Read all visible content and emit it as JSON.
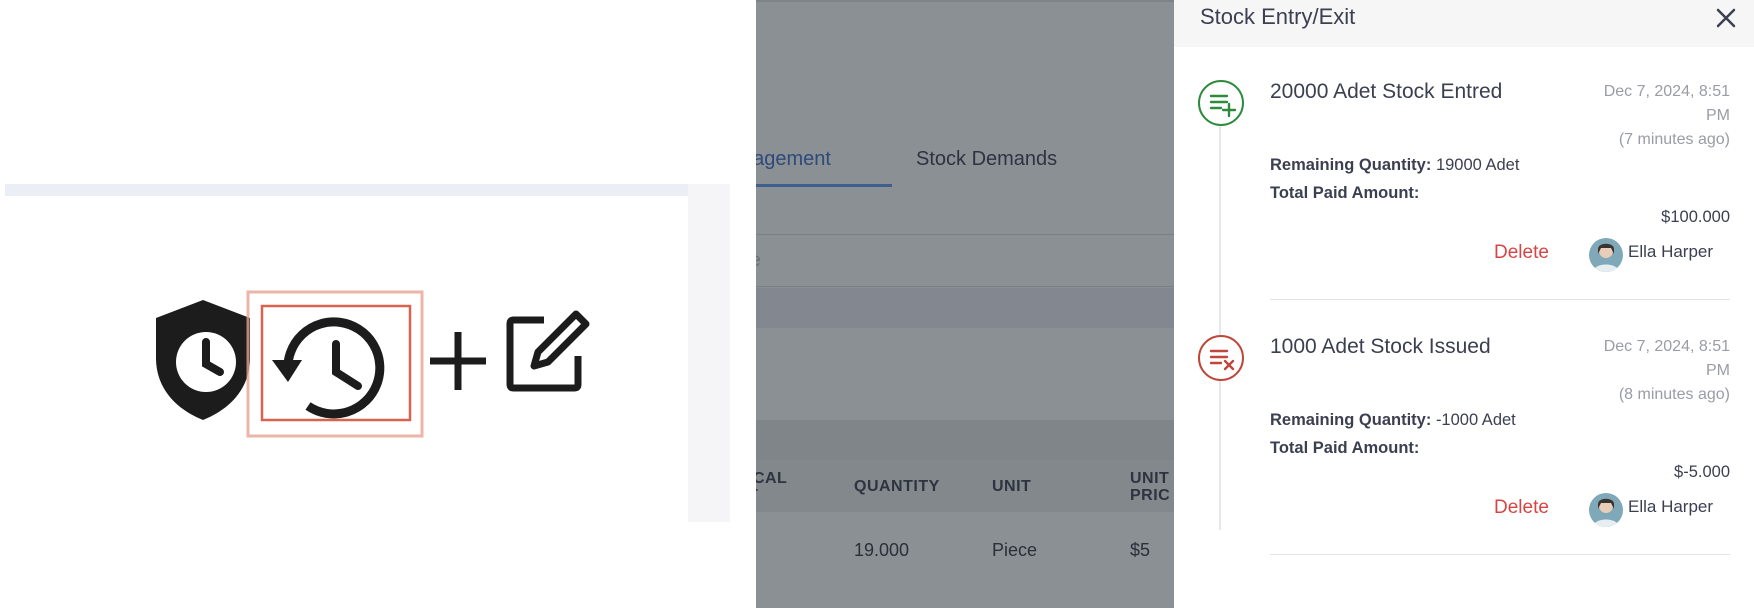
{
  "tabs": {
    "active_label": "nagement",
    "stock_demands_label": "Stock Demands"
  },
  "search": {
    "placeholder_fragment": "le"
  },
  "table": {
    "headers": [
      "ICAL\nT",
      "QUANTITY",
      "UNIT",
      "UNIT\nPRIC"
    ],
    "row": {
      "quantity": "19.000",
      "unit": "Piece",
      "price": "$5"
    }
  },
  "drawer": {
    "title": "Stock Entry/Exit",
    "entries": [
      {
        "type": "entry",
        "title": "20000 Adet Stock Entred",
        "date_line1": "Dec 7, 2024, 8:51",
        "date_line2": "PM",
        "date_ago": "(7 minutes ago)",
        "remaining_label": "Remaining Quantity:",
        "remaining_value": "19000 Adet",
        "paid_label": "Total Paid Amount:",
        "paid_value": "$100.000",
        "delete_label": "Delete",
        "user": "Ella Harper",
        "icon_color": "#2e8b3e"
      },
      {
        "type": "exit",
        "title": "1000 Adet Stock Issued",
        "date_line1": "Dec 7, 2024, 8:51",
        "date_line2": "PM",
        "date_ago": "(8 minutes ago)",
        "remaining_label": "Remaining Quantity:",
        "remaining_value": "-1000 Adet",
        "paid_label": "Total Paid Amount:",
        "paid_value": "$-5.000",
        "delete_label": "Delete",
        "user": "Ella Harper",
        "icon_color": "#c0463a"
      }
    ]
  },
  "icons": {
    "zoom": [
      "shield-clock-icon",
      "history-icon",
      "plus-icon",
      "edit-icon"
    ],
    "close": "close-icon",
    "entry": "playlist-add-icon",
    "exit": "playlist-remove-icon"
  },
  "colors": {
    "delete": "#d64545",
    "active_tab": "#3f5f8c",
    "overlay": "#8b9095",
    "highlight_box": "#e07a6a"
  }
}
